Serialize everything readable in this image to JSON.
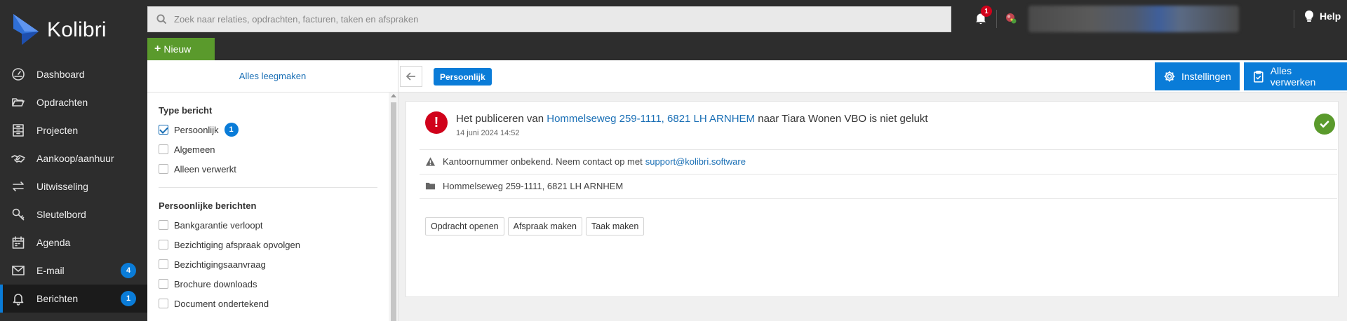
{
  "app": {
    "name": "Kolibri"
  },
  "colors": {
    "sidebar_bg": "#2d2d2d",
    "accent": "#0a7cd8",
    "new_button": "#5a9a2c",
    "error": "#d0021b",
    "success": "#5a9a2c",
    "link": "#1a6fb5"
  },
  "sidebar": {
    "items": [
      {
        "label": "Dashboard",
        "icon": "dashboard-gauge-icon"
      },
      {
        "label": "Opdrachten",
        "icon": "folder-open-icon"
      },
      {
        "label": "Projecten",
        "icon": "projects-building-icon"
      },
      {
        "label": "Aankoop/aanhuur",
        "icon": "handshake-icon"
      },
      {
        "label": "Uitwisseling",
        "icon": "exchange-arrows-icon"
      },
      {
        "label": "Sleutelbord",
        "icon": "key-icon"
      },
      {
        "label": "Agenda",
        "icon": "calendar-icon"
      },
      {
        "label": "E-mail",
        "icon": "envelope-icon",
        "badge": "4"
      },
      {
        "label": "Berichten",
        "icon": "bell-icon",
        "badge": "1",
        "active": true
      }
    ]
  },
  "topbar": {
    "search_placeholder": "Zoek naar relaties, opdrachten, facturen, taken en afspraken",
    "new_button": "Nieuw",
    "notification_count": "1",
    "help_label": "Help"
  },
  "filter": {
    "clear_label": "Alles leegmaken",
    "type_section": {
      "title": "Type bericht",
      "options": [
        {
          "label": "Persoonlijk",
          "checked": true,
          "count": "1"
        },
        {
          "label": "Algemeen",
          "checked": false
        },
        {
          "label": "Alleen verwerkt",
          "checked": false
        }
      ]
    },
    "personal_section": {
      "title": "Persoonlijke berichten",
      "options": [
        {
          "label": "Bankgarantie verloopt",
          "checked": false
        },
        {
          "label": "Bezichtiging afspraak opvolgen",
          "checked": false
        },
        {
          "label": "Bezichtigingsaanvraag",
          "checked": false
        },
        {
          "label": "Brochure downloads",
          "checked": false
        },
        {
          "label": "Document ondertekend",
          "checked": false
        }
      ]
    }
  },
  "toolbar": {
    "active_filter_chip": "Persoonlijk",
    "settings_button": "Instellingen",
    "process_all_button": "Alles verwerken"
  },
  "message": {
    "title_prefix": "Het publiceren van",
    "title_link": "Hommelseweg 259-1111, 6821 LH ARNHEM",
    "title_suffix": "naar Tiara Wonen VBO is niet gelukt",
    "date": "14 juni 2024 14:52",
    "warning_text": "Kantoornummer onbekend. Neem contact op met",
    "warning_link": "support@kolibri.software",
    "address": "Hommelseweg 259-1111, 6821 LH ARNHEM",
    "actions": [
      "Opdracht openen",
      "Afspraak maken",
      "Taak maken"
    ]
  }
}
